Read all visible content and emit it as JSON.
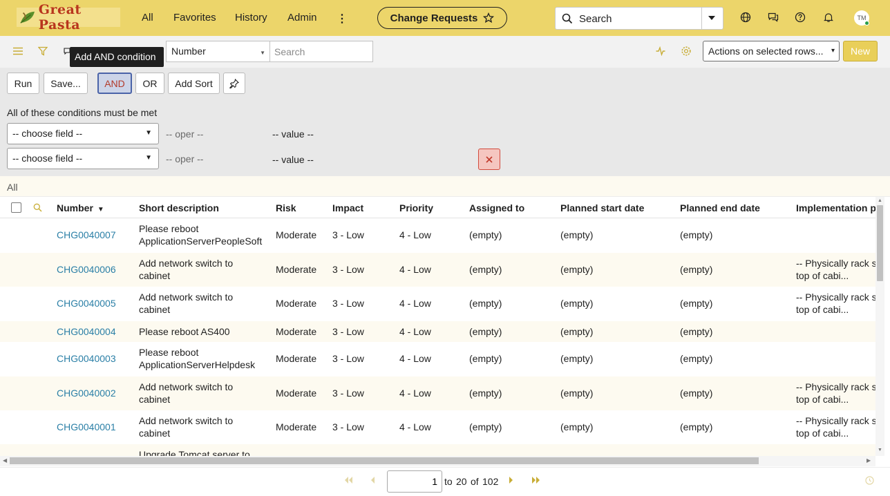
{
  "app": {
    "logo_text": "Great Pasta",
    "accent": "#ecd56a",
    "nav": [
      "All",
      "Favorites",
      "History",
      "Admin"
    ],
    "context_button": "Change Requests",
    "search_placeholder": "Search",
    "avatar_initials": "TM"
  },
  "toolbar": {
    "field_select_value": "Number",
    "search_placeholder": "Search",
    "actions_select": "Actions on selected rows...",
    "new_label": "New",
    "tooltip": "Add AND condition"
  },
  "builder": {
    "buttons": {
      "run": "Run",
      "save": "Save...",
      "and": "AND",
      "or": "OR",
      "add_sort": "Add Sort"
    },
    "heading": "All of these conditions must be met",
    "conditions": [
      {
        "field": "-- choose field --",
        "oper": "-- oper --",
        "value": "-- value --"
      },
      {
        "field": "-- choose field --",
        "oper": "-- oper --",
        "value": "-- value --"
      }
    ]
  },
  "breadcrumb": "All",
  "table": {
    "columns": [
      "Number",
      "Short description",
      "Risk",
      "Impact",
      "Priority",
      "Assigned to",
      "Planned start date",
      "Planned end date",
      "Implementation p"
    ],
    "rows": [
      {
        "number": "CHG0040007",
        "desc": "Please reboot ApplicationServerPeopleSoft",
        "risk": "Moderate",
        "impact": "3 - Low",
        "priority": "4 - Low",
        "assigned": "(empty)",
        "start": "(empty)",
        "end": "(empty)",
        "impl": ""
      },
      {
        "number": "CHG0040006",
        "desc": "Add network switch to cabinet",
        "risk": "Moderate",
        "impact": "3 - Low",
        "priority": "4 - Low",
        "assigned": "(empty)",
        "start": "(empty)",
        "end": "(empty)",
        "impl": "-- Physically rack s top of cabi..."
      },
      {
        "number": "CHG0040005",
        "desc": "Add network switch to cabinet",
        "risk": "Moderate",
        "impact": "3 - Low",
        "priority": "4 - Low",
        "assigned": "(empty)",
        "start": "(empty)",
        "end": "(empty)",
        "impl": "-- Physically rack s top of cabi..."
      },
      {
        "number": "CHG0040004",
        "desc": "Please reboot AS400",
        "risk": "Moderate",
        "impact": "3 - Low",
        "priority": "4 - Low",
        "assigned": "(empty)",
        "start": "(empty)",
        "end": "(empty)",
        "impl": ""
      },
      {
        "number": "CHG0040003",
        "desc": "Please reboot ApplicationServerHelpdesk",
        "risk": "Moderate",
        "impact": "3 - Low",
        "priority": "4 - Low",
        "assigned": "(empty)",
        "start": "(empty)",
        "end": "(empty)",
        "impl": ""
      },
      {
        "number": "CHG0040002",
        "desc": "Add network switch to cabinet",
        "risk": "Moderate",
        "impact": "3 - Low",
        "priority": "4 - Low",
        "assigned": "(empty)",
        "start": "(empty)",
        "end": "(empty)",
        "impl": "-- Physically rack s top of cabi..."
      },
      {
        "number": "CHG0040001",
        "desc": "Add network switch to cabinet",
        "risk": "Moderate",
        "impact": "3 - Low",
        "priority": "4 - Low",
        "assigned": "(empty)",
        "start": "(empty)",
        "end": "(empty)",
        "impl": "-- Physically rack s top of cabi..."
      },
      {
        "number": "",
        "desc": "Upgrade Tomcat server to",
        "risk": "",
        "impact": "",
        "priority": "",
        "assigned": "",
        "start": "",
        "end": "",
        "impl": ""
      }
    ]
  },
  "pagination": {
    "current": "1",
    "to_label": "to",
    "range_end": "20",
    "of_label": "of",
    "total": "102"
  }
}
